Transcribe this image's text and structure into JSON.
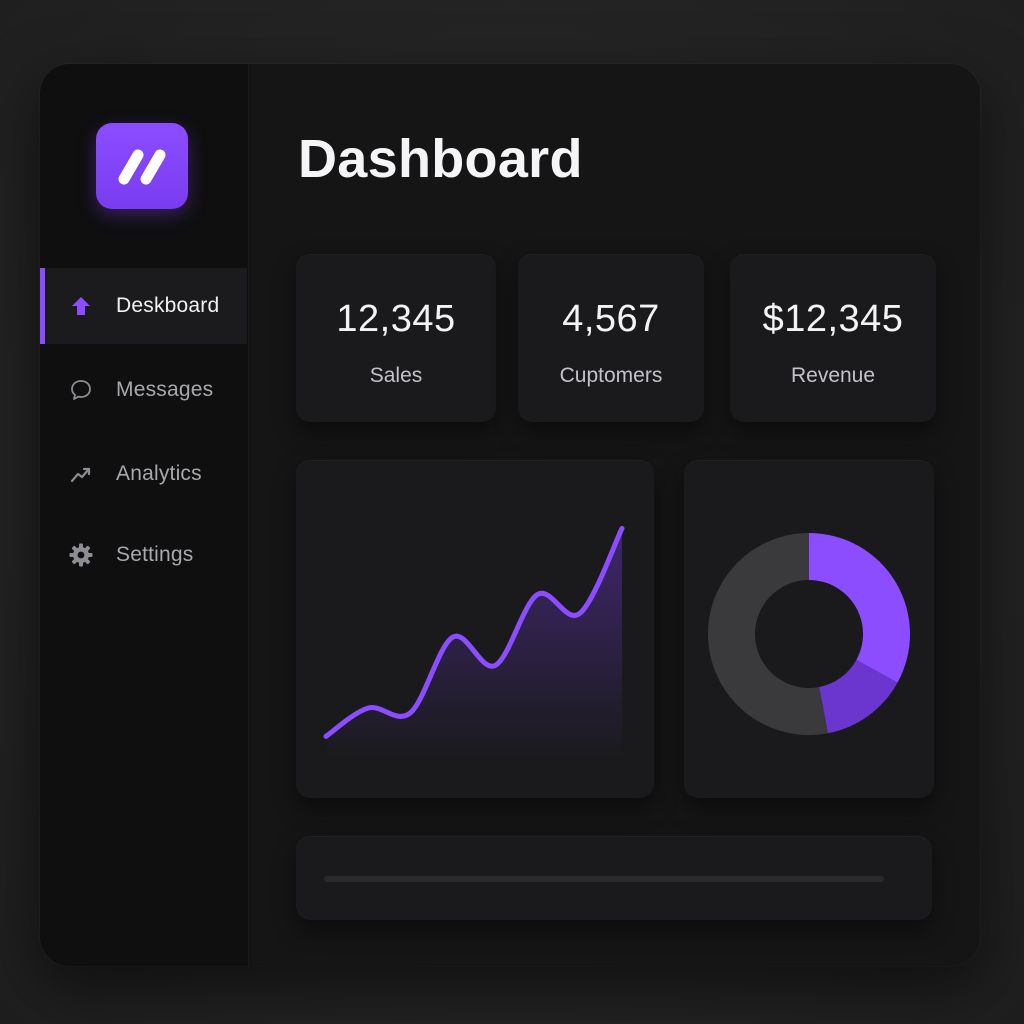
{
  "sidebar": {
    "logo_icon": "slash-logo-icon",
    "items": [
      {
        "label": "Deskboard",
        "icon": "arrow-up-icon",
        "active": true
      },
      {
        "label": "Messages",
        "icon": "chat-bubble-icon",
        "active": false
      },
      {
        "label": "Analytics",
        "icon": "trend-line-icon",
        "active": false
      },
      {
        "label": "Settings",
        "icon": "gear-icon",
        "active": false
      }
    ]
  },
  "main": {
    "title": "Dashboard",
    "stats": [
      {
        "value": "12,345",
        "label": "Sales"
      },
      {
        "value": "4,567",
        "label": "Cuptomers"
      },
      {
        "value": "$12,345",
        "label": "Revenue"
      }
    ]
  },
  "colors": {
    "accent": "#8b4dff",
    "accent_dark": "#6a36cf",
    "background": "#151516",
    "card": "#1a1a1c",
    "donut_track": "#3a3a3d"
  },
  "chart_data": [
    {
      "type": "area",
      "series": [
        {
          "values": [
            10,
            22,
            20,
            52,
            40,
            70,
            62,
            98
          ]
        }
      ],
      "ylim": [
        0,
        110
      ],
      "grid": false
    },
    {
      "type": "pie",
      "variant": "donut",
      "slices": [
        {
          "value": 33,
          "color": "#8b4dff"
        },
        {
          "value": 14,
          "color": "#6a36cf"
        },
        {
          "value": 53,
          "color": "#3a3a3d"
        }
      ]
    }
  ]
}
